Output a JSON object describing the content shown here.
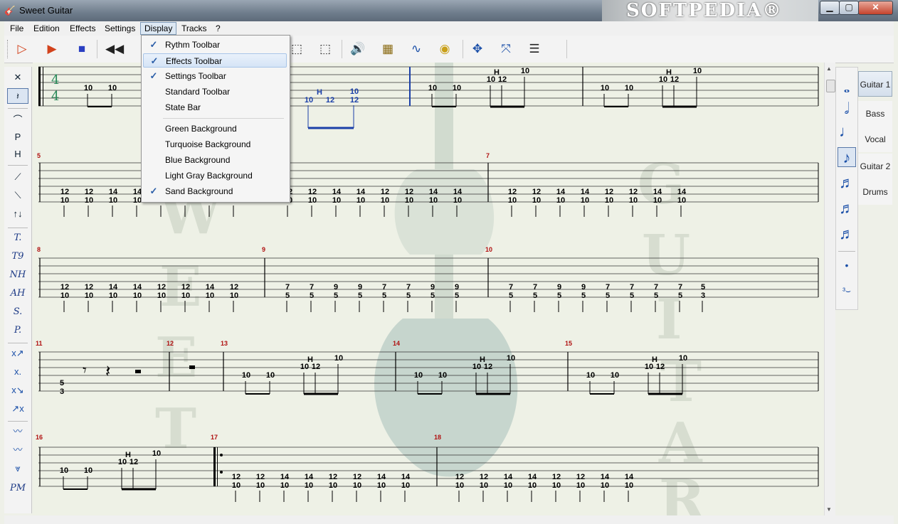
{
  "window": {
    "title": "Sweet Guitar",
    "watermark": "SOFTPEDIA®"
  },
  "menu": [
    "File",
    "Edition",
    "Effects",
    "Settings",
    "Display",
    "Tracks",
    "?"
  ],
  "display_menu": {
    "group1": [
      {
        "label": "Rythm Toolbar",
        "checked": true
      },
      {
        "label": "Effects Toolbar",
        "checked": true
      },
      {
        "label": "Settings Toolbar",
        "checked": true
      },
      {
        "label": "Standard Toolbar",
        "checked": false
      },
      {
        "label": "State Bar",
        "checked": false
      }
    ],
    "group2": [
      {
        "label": "Green Background",
        "checked": false
      },
      {
        "label": "Turquoise Background",
        "checked": false
      },
      {
        "label": "Blue Background",
        "checked": false
      },
      {
        "label": "Light Gray Background",
        "checked": false
      },
      {
        "label": "Sand Background",
        "checked": true
      }
    ]
  },
  "tracks": [
    "Guitar 1",
    "Bass",
    "Vocal",
    "Guitar 2",
    "Drums"
  ],
  "left_tools": [
    "T.",
    "T9",
    "NH",
    "AH",
    "S.",
    "P.",
    "PM"
  ],
  "score": {
    "time_signature": [
      "4",
      "4"
    ],
    "measures": [
      "5",
      "7",
      "8",
      "9",
      "10",
      "11",
      "12",
      "13",
      "14",
      "15",
      "16",
      "17",
      "18"
    ],
    "frets": [
      "10",
      "12",
      "14",
      "7",
      "9",
      "5",
      "3"
    ],
    "technique_mark": "H",
    "watermark_letters": [
      "W",
      "E",
      "E",
      "T",
      "G",
      "U",
      "I",
      "T",
      "A",
      "R"
    ]
  }
}
